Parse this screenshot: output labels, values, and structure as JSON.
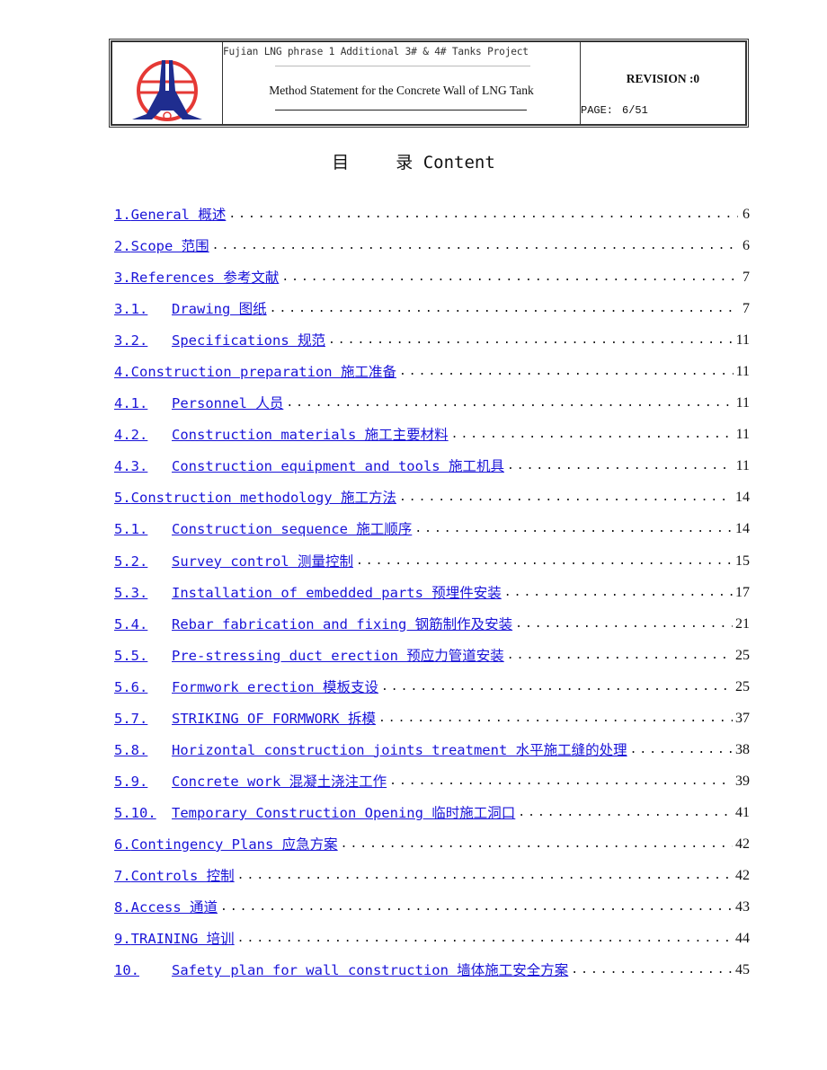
{
  "header": {
    "project": "Fujian LNG phrase 1 Additional 3# & 4# Tanks Project",
    "document_title": "Method Statement for the Concrete Wall of LNG Tank",
    "revision": "REVISION :0",
    "page_label": "PAGE:",
    "page_value": "6/51",
    "logo_icon": "company-logo-icon",
    "colors": {
      "logo_red": "#e53935",
      "logo_blue": "#1f2d8f"
    }
  },
  "toc": {
    "heading_cn": "目",
    "heading_cn2": "录",
    "heading_en": "Content",
    "link_color": "#1a14d8",
    "entries": [
      {
        "num": "1.",
        "title": "General 概述",
        "page": "6",
        "level": 1
      },
      {
        "num": "2.",
        "title": "Scope 范围",
        "page": "6",
        "level": 1
      },
      {
        "num": "3.",
        "title": "References 参考文献",
        "page": "7",
        "level": 1
      },
      {
        "num": "3.1.",
        "title": "Drawing 图纸",
        "page": "7",
        "level": 2
      },
      {
        "num": "3.2.",
        "title": "Specifications 规范",
        "page": "11",
        "level": 2
      },
      {
        "num": "4.",
        "title": "Construction preparation 施工准备",
        "page": "11",
        "level": 1
      },
      {
        "num": "4.1.",
        "title": "Personnel 人员",
        "page": "11",
        "level": 2
      },
      {
        "num": "4.2.",
        "title": "Construction materials 施工主要材料",
        "page": "11",
        "level": 2
      },
      {
        "num": "4.3.",
        "title": "Construction equipment and tools 施工机具",
        "page": "11",
        "level": 2
      },
      {
        "num": "5.",
        "title": "Construction methodology 施工方法",
        "page": "14",
        "level": 1
      },
      {
        "num": "5.1.",
        "title": "Construction sequence 施工顺序",
        "page": "14",
        "level": 2
      },
      {
        "num": "5.2.",
        "title": "Survey control 测量控制",
        "page": "15",
        "level": 2
      },
      {
        "num": "5.3.",
        "title": "Installation of embedded parts 预埋件安装",
        "page": "17",
        "level": 2
      },
      {
        "num": "5.4.",
        "title": "Rebar fabrication and fixing 钢筋制作及安装",
        "page": "21",
        "level": 2
      },
      {
        "num": "5.5.",
        "title": "Pre-stressing duct erection 预应力管道安装",
        "page": "25",
        "level": 2
      },
      {
        "num": "5.6.",
        "title": "Formwork erection 模板支设",
        "page": "25",
        "level": 2
      },
      {
        "num": "5.7.",
        "title": "STRIKING OF FORMWORK 拆模",
        "page": "37",
        "level": 2
      },
      {
        "num": "5.8.",
        "title": "Horizontal construction joints treatment 水平施工缝的处理",
        "page": "38",
        "level": 2
      },
      {
        "num": "5.9.",
        "title": "Concrete work 混凝土浇注工作",
        "page": "39",
        "level": 2
      },
      {
        "num": "5.10.",
        "title": "Temporary Construction Opening 临时施工洞口",
        "page": "41",
        "level": 2
      },
      {
        "num": "6.",
        "title": "Contingency Plans 应急方案",
        "page": "42",
        "level": 1
      },
      {
        "num": "7.",
        "title": "Controls 控制",
        "page": "42",
        "level": 1
      },
      {
        "num": "8.",
        "title": "Access 通道",
        "page": "43",
        "level": 1
      },
      {
        "num": "9.",
        "title": "TRAINING 培训",
        "page": "44",
        "level": 1
      },
      {
        "num": "10.",
        "title": "Safety plan for wall construction 墙体施工安全方案",
        "page": "45",
        "level": 2
      }
    ]
  }
}
